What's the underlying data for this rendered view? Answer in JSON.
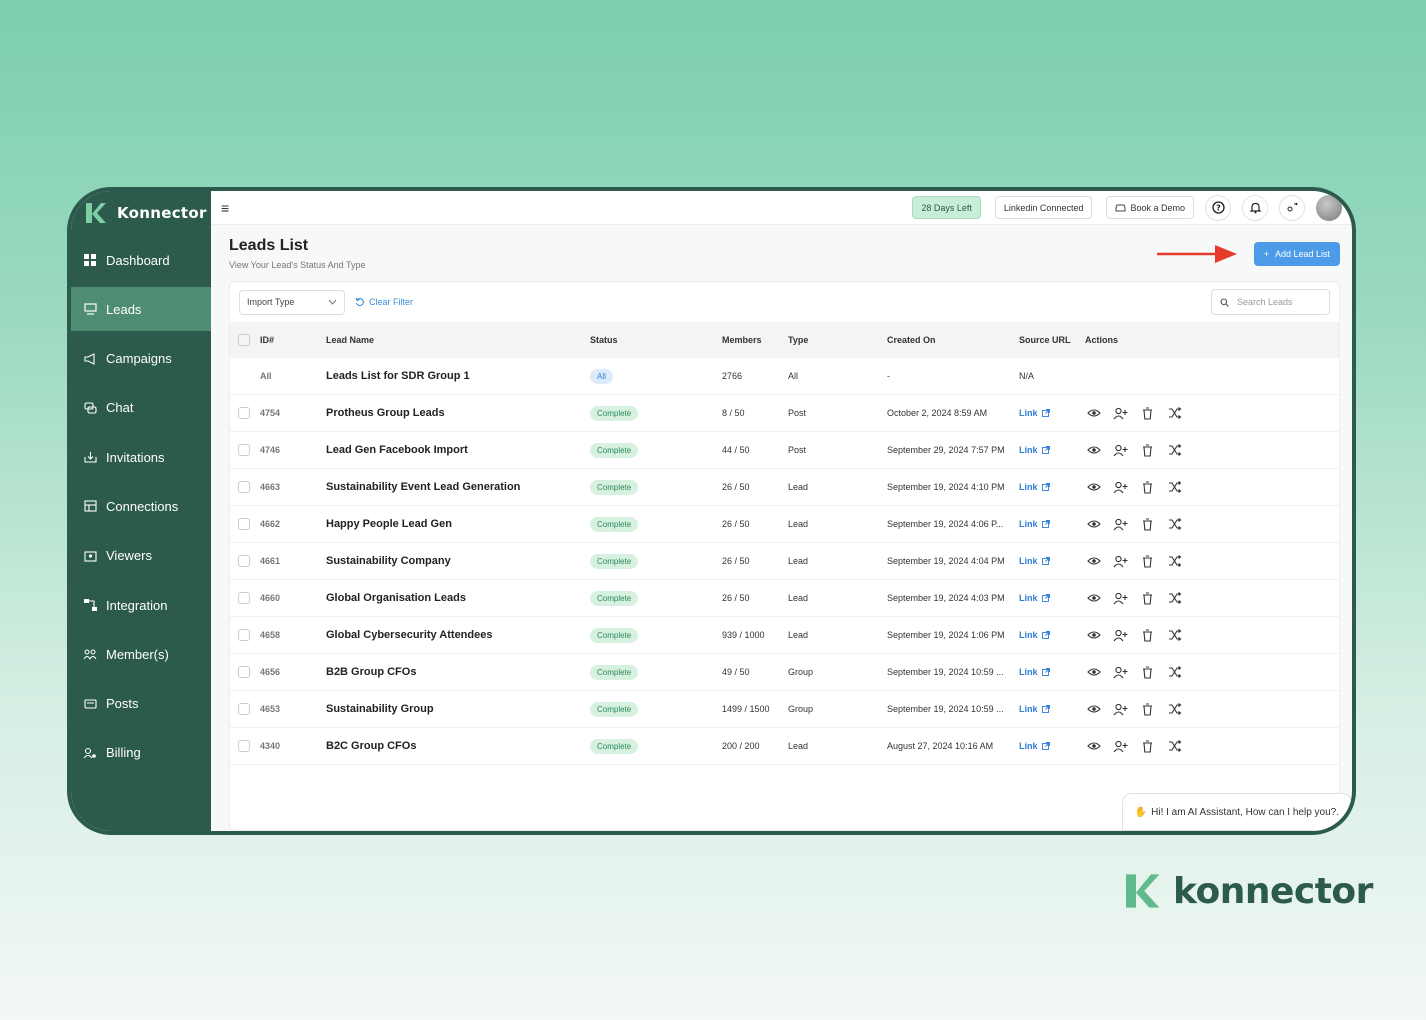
{
  "brand": {
    "name": "Konnector",
    "bottom_name": "konnector",
    "color": "#2c5a4d",
    "accent": "#4e8c74"
  },
  "sidebar": {
    "items": [
      {
        "label": "Dashboard",
        "icon": "dashboard-icon"
      },
      {
        "label": "Leads",
        "icon": "leads-icon",
        "active": true
      },
      {
        "label": "Campaigns",
        "icon": "megaphone-icon"
      },
      {
        "label": "Chat",
        "icon": "chat-icon"
      },
      {
        "label": "Invitations",
        "icon": "invitation-icon"
      },
      {
        "label": "Connections",
        "icon": "connections-icon"
      },
      {
        "label": "Viewers",
        "icon": "viewers-icon"
      },
      {
        "label": "Integration",
        "icon": "integration-icon"
      },
      {
        "label": "Member(s)",
        "icon": "members-icon"
      },
      {
        "label": "Posts",
        "icon": "posts-icon"
      },
      {
        "label": "Billing",
        "icon": "billing-icon"
      }
    ]
  },
  "topbar": {
    "days_left": "28 Days Left",
    "linkedin": "Linkedin Connected",
    "book_demo": "Book a Demo"
  },
  "page": {
    "title": "Leads List",
    "subtitle": "View Your Lead's Status And Type",
    "add_button": "Add Lead List"
  },
  "filters": {
    "import_type": "Import Type",
    "clear": "Clear Filter",
    "search_placeholder": "Search Leads"
  },
  "table": {
    "headers": [
      "ID#",
      "Lead Name",
      "Status",
      "Members",
      "Type",
      "Created On",
      "Source URL",
      "Actions"
    ],
    "summary": {
      "id": "All",
      "name": "Leads List for SDR Group 1",
      "status": "All",
      "members": "2766",
      "type": "All",
      "created": "-",
      "source": "N/A"
    },
    "rows": [
      {
        "id": "4754",
        "name": "Protheus Group Leads",
        "status": "Complete",
        "members": "8 / 50",
        "type": "Post",
        "created": "October 2, 2024 8:59 AM",
        "source": "Link"
      },
      {
        "id": "4746",
        "name": "Lead Gen Facebook Import",
        "status": "Complete",
        "members": "44 / 50",
        "type": "Post",
        "created": "September 29, 2024 7:57 PM",
        "source": "Link"
      },
      {
        "id": "4663",
        "name": "Sustainability Event Lead Generation",
        "status": "Complete",
        "members": "26 / 50",
        "type": "Lead",
        "created": "September 19, 2024 4:10 PM",
        "source": "Link"
      },
      {
        "id": "4662",
        "name": "Happy People Lead Gen",
        "status": "Complete",
        "members": "26 / 50",
        "type": "Lead",
        "created": "September 19, 2024 4:06 P...",
        "source": "Link"
      },
      {
        "id": "4661",
        "name": "Sustainability Company",
        "status": "Complete",
        "members": "26 / 50",
        "type": "Lead",
        "created": "September 19, 2024 4:04 PM",
        "source": "Link"
      },
      {
        "id": "4660",
        "name": "Global Organisation Leads",
        "status": "Complete",
        "members": "26 / 50",
        "type": "Lead",
        "created": "September 19, 2024 4:03 PM",
        "source": "Link"
      },
      {
        "id": "4658",
        "name": "Global Cybersecurity Attendees",
        "status": "Complete",
        "members": "939 / 1000",
        "type": "Lead",
        "created": "September 19, 2024 1:06 PM",
        "source": "Link"
      },
      {
        "id": "4656",
        "name": "B2B Group CFOs",
        "status": "Complete",
        "members": "49 / 50",
        "type": "Group",
        "created": "September 19, 2024 10:59 ...",
        "source": "Link"
      },
      {
        "id": "4653",
        "name": "Sustainability Group",
        "status": "Complete",
        "members": "1499 / 1500",
        "type": "Group",
        "created": "September 19, 2024 10:59 ...",
        "source": "Link"
      },
      {
        "id": "4340",
        "name": "B2C Group CFOs",
        "status": "Complete",
        "members": "200 / 200",
        "type": "Lead",
        "created": "August 27, 2024 10:16 AM",
        "source": "Link"
      }
    ]
  },
  "ai_chat": {
    "text": "Hi! I am AI Assistant, How can I help you?."
  }
}
